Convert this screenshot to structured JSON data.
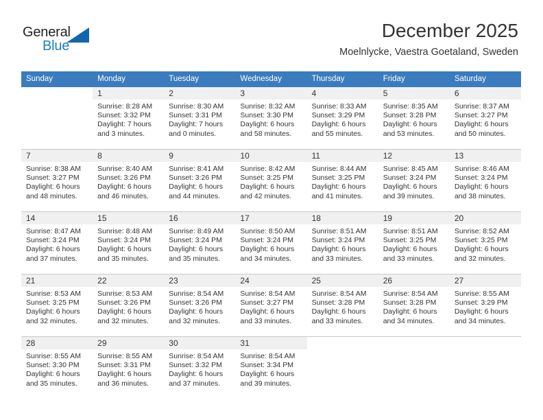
{
  "brand": {
    "name_part1": "General",
    "name_part2": "Blue",
    "triangle_color": "#1266ad",
    "blue_color": "#1a7fc1"
  },
  "header": {
    "title": "December 2025",
    "subtitle": "Moelnlycke, Vaestra Goetaland, Sweden",
    "header_bg": "#3a7cbe",
    "daynum_bg": "#f0f0f0"
  },
  "weekday_headers": [
    "Sunday",
    "Monday",
    "Tuesday",
    "Wednesday",
    "Thursday",
    "Friday",
    "Saturday"
  ],
  "weeks": [
    [
      {
        "day": "",
        "sunrise": "",
        "sunset": "",
        "daylight_1": "",
        "daylight_2": "",
        "blank": true
      },
      {
        "day": "1",
        "sunrise": "Sunrise: 8:28 AM",
        "sunset": "Sunset: 3:32 PM",
        "daylight_1": "Daylight: 7 hours",
        "daylight_2": "and 3 minutes."
      },
      {
        "day": "2",
        "sunrise": "Sunrise: 8:30 AM",
        "sunset": "Sunset: 3:31 PM",
        "daylight_1": "Daylight: 7 hours",
        "daylight_2": "and 0 minutes."
      },
      {
        "day": "3",
        "sunrise": "Sunrise: 8:32 AM",
        "sunset": "Sunset: 3:30 PM",
        "daylight_1": "Daylight: 6 hours",
        "daylight_2": "and 58 minutes."
      },
      {
        "day": "4",
        "sunrise": "Sunrise: 8:33 AM",
        "sunset": "Sunset: 3:29 PM",
        "daylight_1": "Daylight: 6 hours",
        "daylight_2": "and 55 minutes."
      },
      {
        "day": "5",
        "sunrise": "Sunrise: 8:35 AM",
        "sunset": "Sunset: 3:28 PM",
        "daylight_1": "Daylight: 6 hours",
        "daylight_2": "and 53 minutes."
      },
      {
        "day": "6",
        "sunrise": "Sunrise: 8:37 AM",
        "sunset": "Sunset: 3:27 PM",
        "daylight_1": "Daylight: 6 hours",
        "daylight_2": "and 50 minutes."
      }
    ],
    [
      {
        "day": "7",
        "sunrise": "Sunrise: 8:38 AM",
        "sunset": "Sunset: 3:27 PM",
        "daylight_1": "Daylight: 6 hours",
        "daylight_2": "and 48 minutes."
      },
      {
        "day": "8",
        "sunrise": "Sunrise: 8:40 AM",
        "sunset": "Sunset: 3:26 PM",
        "daylight_1": "Daylight: 6 hours",
        "daylight_2": "and 46 minutes."
      },
      {
        "day": "9",
        "sunrise": "Sunrise: 8:41 AM",
        "sunset": "Sunset: 3:26 PM",
        "daylight_1": "Daylight: 6 hours",
        "daylight_2": "and 44 minutes."
      },
      {
        "day": "10",
        "sunrise": "Sunrise: 8:42 AM",
        "sunset": "Sunset: 3:25 PM",
        "daylight_1": "Daylight: 6 hours",
        "daylight_2": "and 42 minutes."
      },
      {
        "day": "11",
        "sunrise": "Sunrise: 8:44 AM",
        "sunset": "Sunset: 3:25 PM",
        "daylight_1": "Daylight: 6 hours",
        "daylight_2": "and 41 minutes."
      },
      {
        "day": "12",
        "sunrise": "Sunrise: 8:45 AM",
        "sunset": "Sunset: 3:24 PM",
        "daylight_1": "Daylight: 6 hours",
        "daylight_2": "and 39 minutes."
      },
      {
        "day": "13",
        "sunrise": "Sunrise: 8:46 AM",
        "sunset": "Sunset: 3:24 PM",
        "daylight_1": "Daylight: 6 hours",
        "daylight_2": "and 38 minutes."
      }
    ],
    [
      {
        "day": "14",
        "sunrise": "Sunrise: 8:47 AM",
        "sunset": "Sunset: 3:24 PM",
        "daylight_1": "Daylight: 6 hours",
        "daylight_2": "and 37 minutes."
      },
      {
        "day": "15",
        "sunrise": "Sunrise: 8:48 AM",
        "sunset": "Sunset: 3:24 PM",
        "daylight_1": "Daylight: 6 hours",
        "daylight_2": "and 35 minutes."
      },
      {
        "day": "16",
        "sunrise": "Sunrise: 8:49 AM",
        "sunset": "Sunset: 3:24 PM",
        "daylight_1": "Daylight: 6 hours",
        "daylight_2": "and 35 minutes."
      },
      {
        "day": "17",
        "sunrise": "Sunrise: 8:50 AM",
        "sunset": "Sunset: 3:24 PM",
        "daylight_1": "Daylight: 6 hours",
        "daylight_2": "and 34 minutes."
      },
      {
        "day": "18",
        "sunrise": "Sunrise: 8:51 AM",
        "sunset": "Sunset: 3:24 PM",
        "daylight_1": "Daylight: 6 hours",
        "daylight_2": "and 33 minutes."
      },
      {
        "day": "19",
        "sunrise": "Sunrise: 8:51 AM",
        "sunset": "Sunset: 3:25 PM",
        "daylight_1": "Daylight: 6 hours",
        "daylight_2": "and 33 minutes."
      },
      {
        "day": "20",
        "sunrise": "Sunrise: 8:52 AM",
        "sunset": "Sunset: 3:25 PM",
        "daylight_1": "Daylight: 6 hours",
        "daylight_2": "and 32 minutes."
      }
    ],
    [
      {
        "day": "21",
        "sunrise": "Sunrise: 8:53 AM",
        "sunset": "Sunset: 3:25 PM",
        "daylight_1": "Daylight: 6 hours",
        "daylight_2": "and 32 minutes."
      },
      {
        "day": "22",
        "sunrise": "Sunrise: 8:53 AM",
        "sunset": "Sunset: 3:26 PM",
        "daylight_1": "Daylight: 6 hours",
        "daylight_2": "and 32 minutes."
      },
      {
        "day": "23",
        "sunrise": "Sunrise: 8:54 AM",
        "sunset": "Sunset: 3:26 PM",
        "daylight_1": "Daylight: 6 hours",
        "daylight_2": "and 32 minutes."
      },
      {
        "day": "24",
        "sunrise": "Sunrise: 8:54 AM",
        "sunset": "Sunset: 3:27 PM",
        "daylight_1": "Daylight: 6 hours",
        "daylight_2": "and 33 minutes."
      },
      {
        "day": "25",
        "sunrise": "Sunrise: 8:54 AM",
        "sunset": "Sunset: 3:28 PM",
        "daylight_1": "Daylight: 6 hours",
        "daylight_2": "and 33 minutes."
      },
      {
        "day": "26",
        "sunrise": "Sunrise: 8:54 AM",
        "sunset": "Sunset: 3:28 PM",
        "daylight_1": "Daylight: 6 hours",
        "daylight_2": "and 34 minutes."
      },
      {
        "day": "27",
        "sunrise": "Sunrise: 8:55 AM",
        "sunset": "Sunset: 3:29 PM",
        "daylight_1": "Daylight: 6 hours",
        "daylight_2": "and 34 minutes."
      }
    ],
    [
      {
        "day": "28",
        "sunrise": "Sunrise: 8:55 AM",
        "sunset": "Sunset: 3:30 PM",
        "daylight_1": "Daylight: 6 hours",
        "daylight_2": "and 35 minutes."
      },
      {
        "day": "29",
        "sunrise": "Sunrise: 8:55 AM",
        "sunset": "Sunset: 3:31 PM",
        "daylight_1": "Daylight: 6 hours",
        "daylight_2": "and 36 minutes."
      },
      {
        "day": "30",
        "sunrise": "Sunrise: 8:54 AM",
        "sunset": "Sunset: 3:32 PM",
        "daylight_1": "Daylight: 6 hours",
        "daylight_2": "and 37 minutes."
      },
      {
        "day": "31",
        "sunrise": "Sunrise: 8:54 AM",
        "sunset": "Sunset: 3:34 PM",
        "daylight_1": "Daylight: 6 hours",
        "daylight_2": "and 39 minutes."
      },
      {
        "day": "",
        "sunrise": "",
        "sunset": "",
        "daylight_1": "",
        "daylight_2": "",
        "blank": true
      },
      {
        "day": "",
        "sunrise": "",
        "sunset": "",
        "daylight_1": "",
        "daylight_2": "",
        "blank": true
      },
      {
        "day": "",
        "sunrise": "",
        "sunset": "",
        "daylight_1": "",
        "daylight_2": "",
        "blank": true
      }
    ]
  ]
}
